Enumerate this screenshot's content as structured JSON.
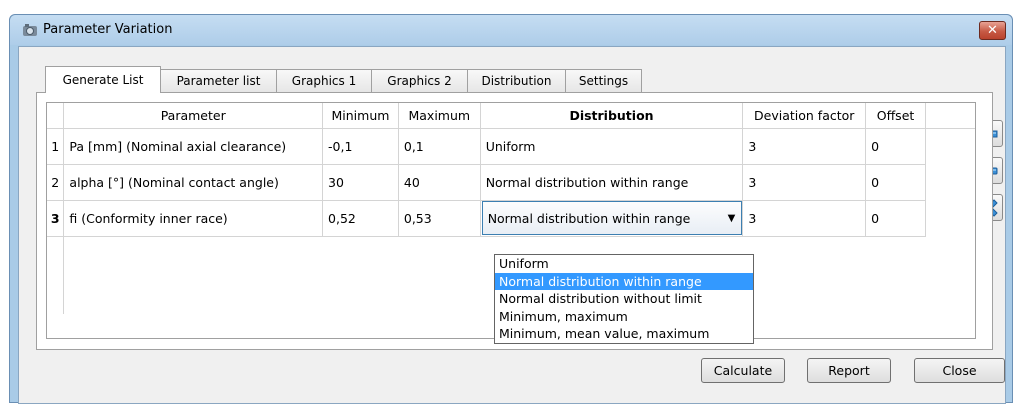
{
  "window": {
    "title": "Parameter Variation",
    "close_symbol": "✕"
  },
  "tabs": [
    {
      "label": "Generate List",
      "active": true
    },
    {
      "label": "Parameter list",
      "active": false
    },
    {
      "label": "Graphics 1",
      "active": false
    },
    {
      "label": "Graphics 2",
      "active": false
    },
    {
      "label": "Distribution",
      "active": false
    },
    {
      "label": "Settings",
      "active": false
    }
  ],
  "table": {
    "headers": {
      "parameter": "Parameter",
      "minimum": "Minimum",
      "maximum": "Maximum",
      "distribution": "Distribution",
      "deviation_factor": "Deviation factor",
      "offset": "Offset"
    },
    "rows": [
      {
        "num": "1",
        "parameter": "Pa [mm]  (Nominal axial clearance)",
        "minimum": "-0,1",
        "maximum": "0,1",
        "distribution": "Uniform",
        "deviation_factor": "3",
        "offset": "0"
      },
      {
        "num": "2",
        "parameter": "alpha [°]  (Nominal contact angle)",
        "minimum": "30",
        "maximum": "40",
        "distribution": "Normal distribution within range",
        "deviation_factor": "3",
        "offset": "0"
      },
      {
        "num": "3",
        "parameter": "fi (Conformity inner race)",
        "minimum": "0,52",
        "maximum": "0,53",
        "distribution": "Normal distribution within range",
        "deviation_factor": "3",
        "offset": "0"
      }
    ]
  },
  "distribution_dropdown": {
    "selected": "Normal distribution within range",
    "options": [
      "Uniform",
      "Normal distribution within range",
      "Normal distribution without limit",
      "Minimum, maximum",
      "Minimum, mean value, maximum"
    ]
  },
  "side_buttons": {
    "add_icon": "plus-icon",
    "remove_icon": "minus-icon",
    "delete_icon": "x-icon"
  },
  "buttons": {
    "calculate": "Calculate",
    "report": "Report",
    "close": "Close"
  },
  "colors": {
    "accent": "#3399ff",
    "titlebar": "#aecde9",
    "close_button": "#c75a45"
  }
}
